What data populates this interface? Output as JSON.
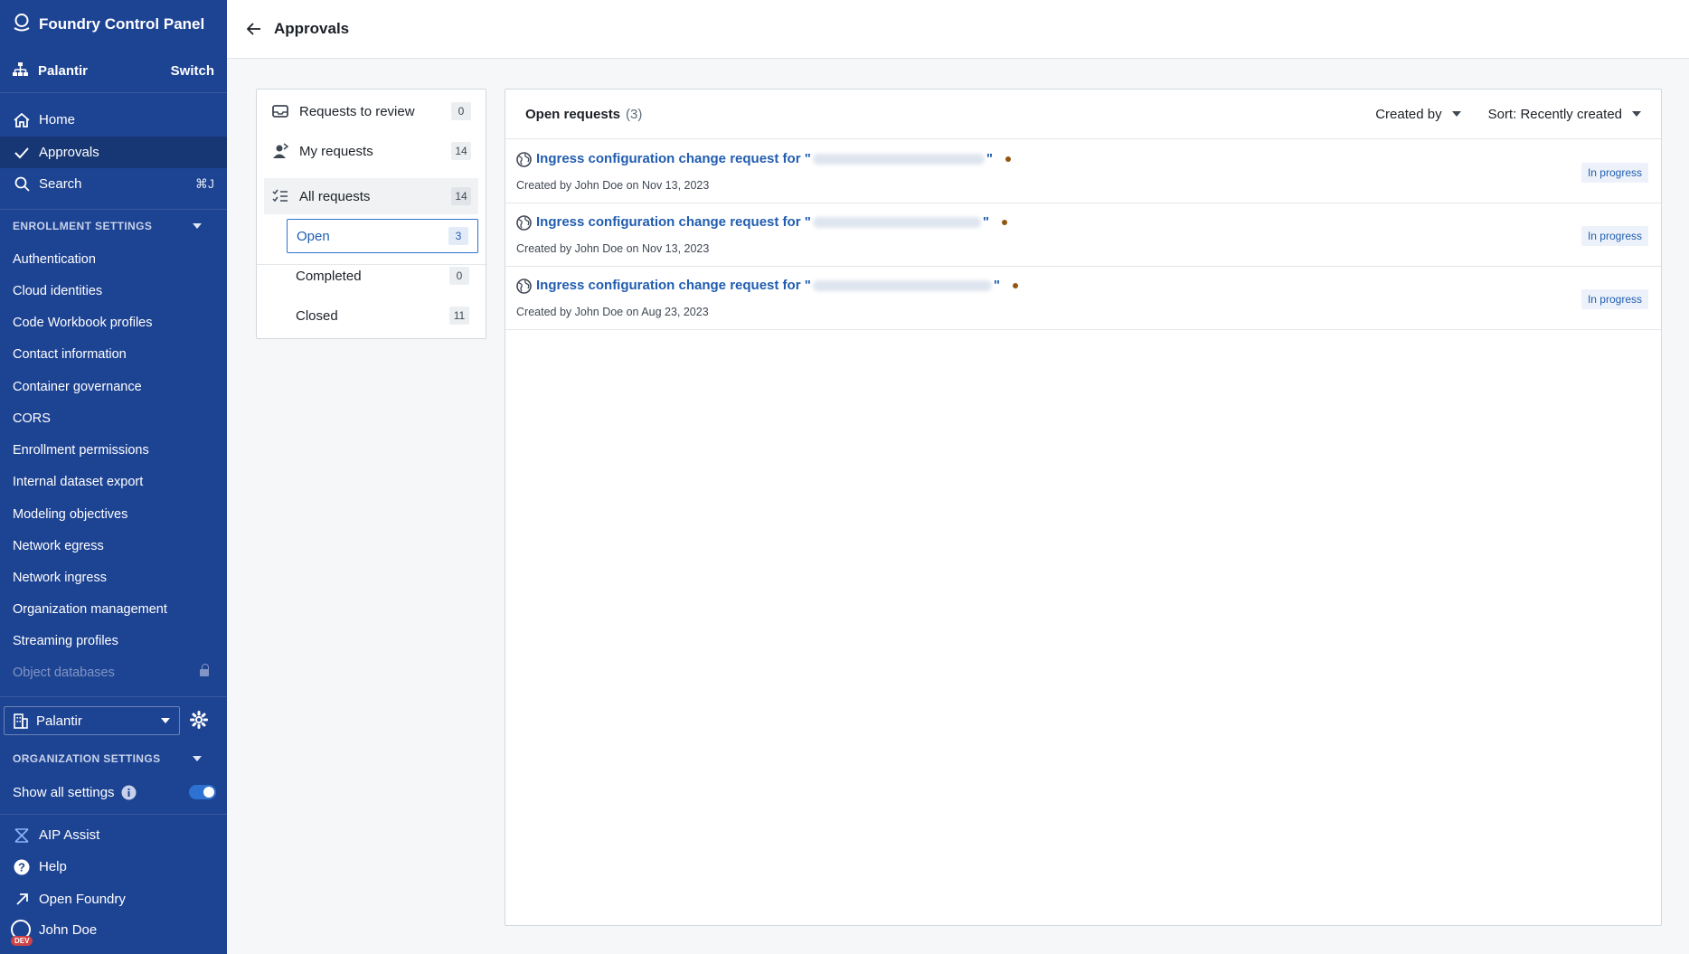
{
  "app": {
    "title": "Foundry Control Panel"
  },
  "org_switch": {
    "name": "Palantir",
    "switch_label": "Switch"
  },
  "nav": {
    "home": "Home",
    "approvals": "Approvals",
    "search": "Search",
    "search_shortcut": "⌘J"
  },
  "enrollment": {
    "header": "ENROLLMENT SETTINGS",
    "items": [
      "Authentication",
      "Cloud identities",
      "Code Workbook profiles",
      "Contact information",
      "Container governance",
      "CORS",
      "Enrollment permissions",
      "Internal dataset export",
      "Modeling objectives",
      "Network egress",
      "Network ingress",
      "Organization management",
      "Streaming profiles"
    ],
    "disabled_item": "Object databases"
  },
  "organization": {
    "select_value": "Palantir",
    "header": "ORGANIZATION SETTINGS",
    "show_all_label": "Show all settings",
    "show_all_on": true
  },
  "footer": {
    "aip": "AIP Assist",
    "help": "Help",
    "open_foundry": "Open Foundry",
    "user": "John Doe",
    "env_badge": "DEV"
  },
  "page": {
    "title": "Approvals"
  },
  "filters": {
    "requests_to_review": {
      "label": "Requests to review",
      "count": "0"
    },
    "my_requests": {
      "label": "My requests",
      "count": "14"
    },
    "all_requests": {
      "label": "All requests",
      "count": "14"
    },
    "open": {
      "label": "Open",
      "count": "3"
    },
    "completed": {
      "label": "Completed",
      "count": "0"
    },
    "closed": {
      "label": "Closed",
      "count": "11"
    }
  },
  "list": {
    "title": "Open requests",
    "count": "(3)",
    "created_by_label": "Created by",
    "sort_label": "Sort: Recently created",
    "rows": [
      {
        "title_prefix": "Ingress configuration change request for \"",
        "title_suffix": "\"",
        "meta": "Created by John Doe on Nov 13, 2023",
        "status": "In progress"
      },
      {
        "title_prefix": "Ingress configuration change request for \"",
        "title_suffix": "\"",
        "meta": "Created by John Doe on Nov 13, 2023",
        "status": "In progress"
      },
      {
        "title_prefix": "Ingress configuration change request for \"",
        "title_suffix": "\"",
        "meta": "Created by John Doe on Aug 23, 2023",
        "status": "In progress"
      }
    ]
  },
  "colors": {
    "sidebar": "#1d4393",
    "sidebar_active": "#163674",
    "link": "#215db0",
    "accent": "#2d72d2"
  }
}
